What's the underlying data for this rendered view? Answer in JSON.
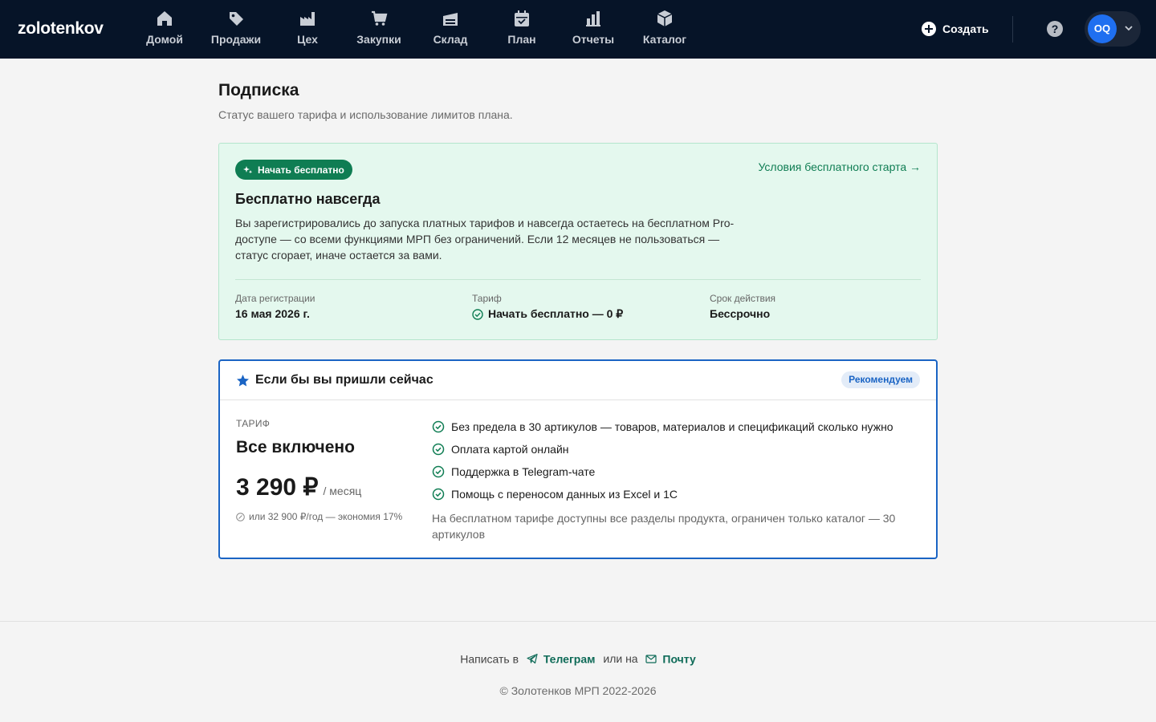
{
  "app": {
    "logo": "zolotenkov"
  },
  "nav": {
    "items": [
      {
        "label": "Домой",
        "icon": "home-icon"
      },
      {
        "label": "Продажи",
        "icon": "tag-icon"
      },
      {
        "label": "Цех",
        "icon": "factory-icon"
      },
      {
        "label": "Закупки",
        "icon": "cart-icon"
      },
      {
        "label": "Склад",
        "icon": "warehouse-icon"
      },
      {
        "label": "План",
        "icon": "calendar-icon"
      },
      {
        "label": "Отчеты",
        "icon": "bar-chart-icon"
      },
      {
        "label": "Каталог",
        "icon": "box-icon"
      }
    ],
    "create_label": "Создать",
    "help_label": "?",
    "avatar_initials": "OQ"
  },
  "page": {
    "title": "Подписка",
    "subtitle": "Статус вашего тарифа и использование лимитов плана."
  },
  "free_plan": {
    "badge": "Начать бесплатно",
    "terms_link": "Условия бесплатного старта →",
    "title": "Бесплатно навсегда",
    "description": "Вы зарегистрировались до запуска платных тарифов и навсегда остаетесь на бесплатном Pro-доступе — со всеми функциями МРП без ограничений. Если 12 месяцев не пользоваться — статус сгорает, иначе остается за вами.",
    "meta": [
      {
        "key": "Дата регистрации",
        "value": "16 мая 2026 г."
      },
      {
        "key": "Тариф",
        "value": "Начать бесплатно — 0 ₽"
      },
      {
        "key": "Срок действия",
        "value": "Бессрочно"
      }
    ]
  },
  "recommended": {
    "title": "Если бы вы пришли сейчас",
    "badge": "Рекомендуем",
    "plan_label": "ТАРИФ",
    "plan_name": "Все включено",
    "price": "3 290 ₽",
    "period": "/ месяц",
    "yearly": "или 32 900 ₽/год — экономия 17%",
    "features": [
      "Без предела в 30 артикулов — товаров, материалов и спецификаций сколько нужно",
      "Оплата картой онлайн",
      "Поддержка в Telegram-чате",
      "Помощь с переносом данных из Excel и 1С"
    ],
    "note": "На бесплатном тарифе доступны все разделы продукта, ограничен только каталог — 30 артикулов"
  },
  "footer": {
    "write_prefix": "Написать в",
    "telegram": "Телеграм",
    "or": "или на",
    "mail": "Почту",
    "copyright": "© Золотенков МРП 2022-2026"
  },
  "colors": {
    "topbar": "#061428",
    "accent_green": "#0f7d53",
    "accent_blue": "#1a64c4",
    "free_card_bg": "#e4f8ee",
    "avatar": "#1f6ff0"
  }
}
